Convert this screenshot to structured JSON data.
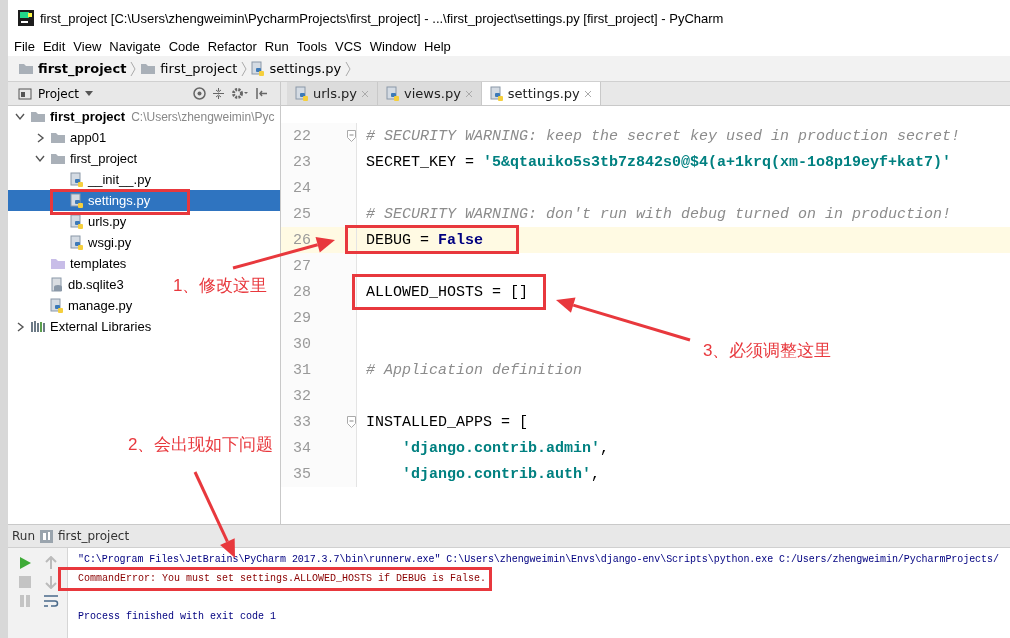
{
  "window": {
    "title": "first_project [C:\\Users\\zhengweimin\\PycharmProjects\\first_project] - ...\\first_project\\settings.py [first_project] - PyCharm"
  },
  "menu": [
    "File",
    "Edit",
    "View",
    "Navigate",
    "Code",
    "Refactor",
    "Run",
    "Tools",
    "VCS",
    "Window",
    "Help"
  ],
  "breadcrumb": [
    {
      "kind": "project",
      "label": "first_project"
    },
    {
      "kind": "folder",
      "label": "first_project"
    },
    {
      "kind": "python",
      "label": "settings.py"
    }
  ],
  "project_panel": {
    "title": "Project"
  },
  "tabs": [
    {
      "label": "urls.py",
      "selected": false
    },
    {
      "label": "views.py",
      "selected": false
    },
    {
      "label": "settings.py",
      "selected": true
    }
  ],
  "tree": [
    {
      "kind": "folder",
      "label": "first_project",
      "path": "C:\\Users\\zhengweimin\\Pyc",
      "expanded": true,
      "selected": false,
      "children": [
        {
          "kind": "folder",
          "label": "app01",
          "expanded": false,
          "selected": false
        },
        {
          "kind": "folder",
          "label": "first_project",
          "expanded": true,
          "selected": false,
          "children": [
            {
              "kind": "python",
              "label": "__init__.py",
              "selected": false
            },
            {
              "kind": "python",
              "label": "settings.py",
              "selected": true
            },
            {
              "kind": "python",
              "label": "urls.py",
              "selected": false
            },
            {
              "kind": "python",
              "label": "wsgi.py",
              "selected": false
            }
          ]
        },
        {
          "kind": "templates",
          "label": "templates",
          "selected": false
        },
        {
          "kind": "database",
          "label": "db.sqlite3",
          "selected": false
        },
        {
          "kind": "python",
          "label": "manage.py",
          "selected": false
        }
      ]
    },
    {
      "kind": "library",
      "label": "External Libraries",
      "expanded": false,
      "selected": false
    }
  ],
  "editor": {
    "lines": [
      {
        "number": "22",
        "fold": true,
        "tokens": [
          {
            "kind": "comment",
            "text": "# SECURITY WARNING: keep the secret key used in production secret!"
          }
        ]
      },
      {
        "number": "23",
        "tokens": [
          {
            "kind": "name",
            "text": "SECRET_KEY = "
          },
          {
            "kind": "string",
            "text": "'5&qtauiko5s3tb7z842s0@$4(a+1krq(xm-1o8p19eyf+kat7)'"
          }
        ]
      },
      {
        "number": "24"
      },
      {
        "number": "25",
        "tokens": [
          {
            "kind": "comment",
            "text": "# SECURITY WARNING: don't run with debug turned on in production!"
          }
        ]
      },
      {
        "number": "26",
        "current": true,
        "tokens": [
          {
            "kind": "name",
            "text": "DEBUG = "
          },
          {
            "kind": "keyword",
            "text": "False"
          }
        ]
      },
      {
        "number": "27"
      },
      {
        "number": "28",
        "tokens": [
          {
            "kind": "name",
            "text": "ALLOWED_HOSTS = []"
          }
        ]
      },
      {
        "number": "29"
      },
      {
        "number": "30"
      },
      {
        "number": "31",
        "tokens": [
          {
            "kind": "comment",
            "text": "# Application definition"
          }
        ]
      },
      {
        "number": "32"
      },
      {
        "number": "33",
        "fold": true,
        "tokens": [
          {
            "kind": "name",
            "text": "INSTALLED_APPS = ["
          }
        ]
      },
      {
        "number": "34",
        "indented": true,
        "tokens": [
          {
            "kind": "string",
            "text": "'django.contrib.admin'"
          },
          {
            "kind": "name",
            "text": ","
          }
        ]
      },
      {
        "number": "35",
        "indented": true,
        "tokens": [
          {
            "kind": "string",
            "text": "'django.contrib.auth'"
          },
          {
            "kind": "name",
            "text": ","
          }
        ]
      }
    ]
  },
  "run_panel": {
    "title": "Run",
    "config": "first_project",
    "output": [
      {
        "kind": "command",
        "text": "\"C:\\Program Files\\JetBrains\\PyCharm 2017.3.7\\bin\\runnerw.exe\" C:\\Users\\zhengweimin\\Envs\\django-env\\Scripts\\python.exe C:/Users/zhengweimin/PycharmProjects/"
      },
      {
        "kind": "error",
        "text": "CommandError: You must set settings.ALLOWED_HOSTS if DEBUG is False."
      },
      {
        "kind": "blank"
      },
      {
        "kind": "info",
        "text": "Process finished with exit code 1"
      }
    ]
  },
  "annotations": [
    {
      "text": "1、修改这里"
    },
    {
      "text": "2、会出现如下问题"
    },
    {
      "text": "3、必须调整这里"
    }
  ]
}
